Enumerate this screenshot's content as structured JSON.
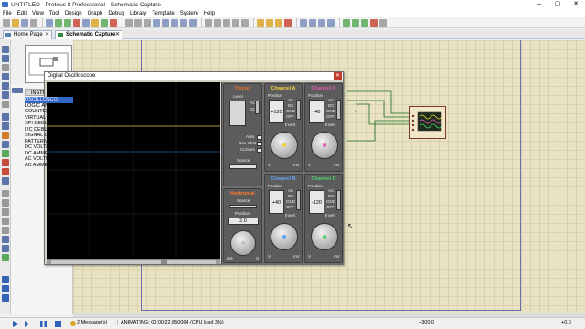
{
  "window": {
    "title": "UNTITLED - Proteus 8 Professional - Schematic Capture"
  },
  "menu": [
    "File",
    "Edit",
    "View",
    "Tool",
    "Design",
    "Graph",
    "Debug",
    "Library",
    "Template",
    "System",
    "Help"
  ],
  "tabs": [
    {
      "label": "Home Page",
      "icon": "home-icon"
    },
    {
      "label": "Schematic Capture",
      "icon": "schematic-icon"
    }
  ],
  "instruments": {
    "header": "INSTR",
    "items": [
      "OSCILLOSCO",
      "LOGIC AN",
      "COUNTER",
      "VIRTUAL",
      "SPI DEBU",
      "I2C DEBU",
      "SIGNAL G",
      "PATTERN",
      "DC VOLTM",
      "DC AMMET",
      "AC VOLTM",
      "AC AMMET"
    ],
    "selected_index": 0
  },
  "oscilloscope": {
    "title": "Digital Oscilloscope",
    "trigger": {
      "label": "Trigger",
      "level_label": "Level",
      "coupling": [
        "AC",
        "DC"
      ],
      "modes": [
        "Auto",
        "One-Shot",
        "Cursors"
      ],
      "source_label": "Source"
    },
    "horizontal": {
      "label": "Horizontal",
      "source_label": "Source",
      "position_label": "Position",
      "position_value": "2.0",
      "units": [
        "mS",
        "S"
      ]
    },
    "channel_a": {
      "label": "Channel A",
      "position_label": "Position",
      "position_value": "+120",
      "coupling": [
        "AC",
        "DC",
        "GND",
        "OFF"
      ],
      "invert": "Invert",
      "units": [
        "V",
        "mV"
      ]
    },
    "channel_b": {
      "label": "Channel B",
      "position_label": "Position",
      "position_value": "+40",
      "coupling": [
        "AC",
        "DC",
        "GND",
        "OFF"
      ],
      "invert": "Invert",
      "units": [
        "V",
        "mV"
      ]
    },
    "channel_c": {
      "label": "Channel C",
      "position_label": "Position",
      "position_value": "-40",
      "coupling": [
        "AC",
        "DC",
        "GND",
        "OFF"
      ],
      "invert": "Invert",
      "units": [
        "V",
        "mV"
      ]
    },
    "channel_d": {
      "label": "Channel D",
      "position_label": "Position",
      "position_value": "-120",
      "coupling": [
        "AC",
        "DC",
        "GND",
        "OFF"
      ],
      "invert": "Invert",
      "units": [
        "V",
        "mV"
      ]
    },
    "colors": {
      "a": "#f0d040",
      "b": "#5fa0f0",
      "c": "#e05ab0",
      "d": "#4cd06c",
      "trigger": "#e07030",
      "horizontal": "#ff7a28"
    }
  },
  "status": {
    "messages": "2 Message(s)",
    "animating": "ANIMATING: 00:00:22.850064 (CPU load 3%)",
    "coord_x": "+300.0",
    "coord_y": "+0.0"
  }
}
